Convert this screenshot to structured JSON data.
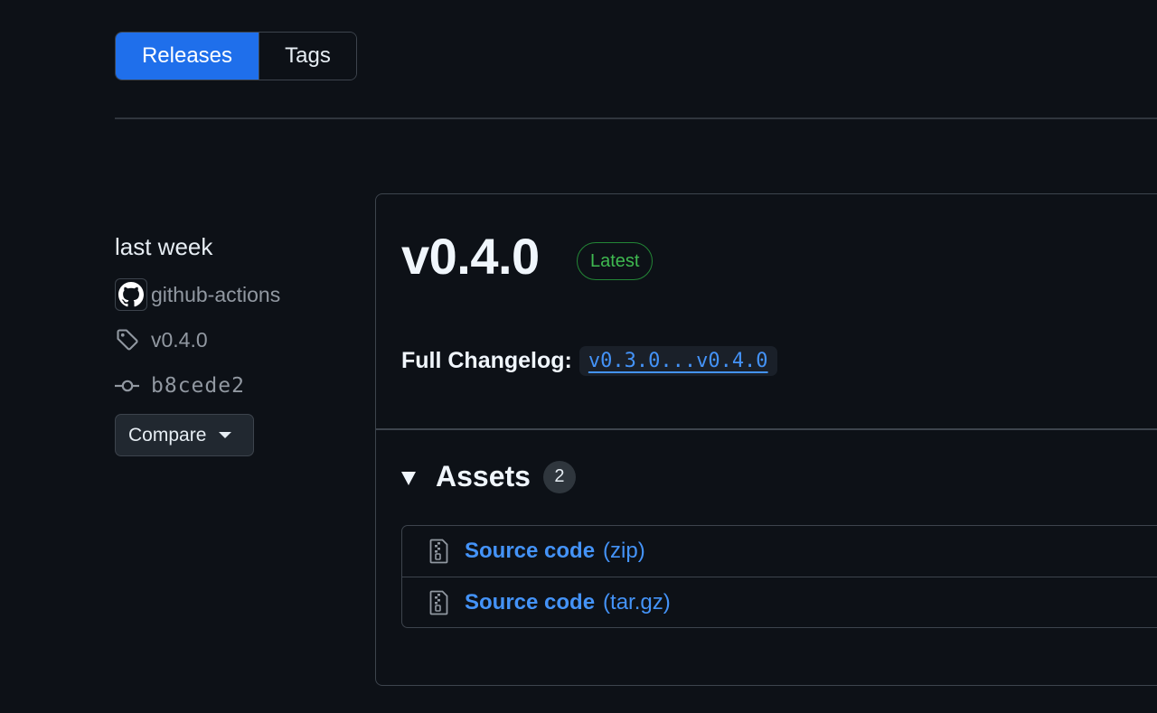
{
  "tabs": [
    {
      "label": "Releases",
      "active": true
    },
    {
      "label": "Tags",
      "active": false
    }
  ],
  "sidebar": {
    "time": "last week",
    "author": "github-actions",
    "tag": "v0.4.0",
    "commit": "b8cede2",
    "compare_label": "Compare"
  },
  "release": {
    "title": "v0.4.0",
    "badge": "Latest",
    "changelog_label": "Full Changelog:",
    "changelog_link": "v0.3.0...v0.4.0"
  },
  "assets": {
    "title": "Assets",
    "count": "2",
    "items": [
      {
        "name": "Source code",
        "ext": "(zip)"
      },
      {
        "name": "Source code",
        "ext": "(tar.gz)"
      }
    ]
  },
  "colors": {
    "accent": "#1f6feb",
    "link": "#4493f8",
    "success": "#3fb950",
    "background": "#0d1117"
  }
}
